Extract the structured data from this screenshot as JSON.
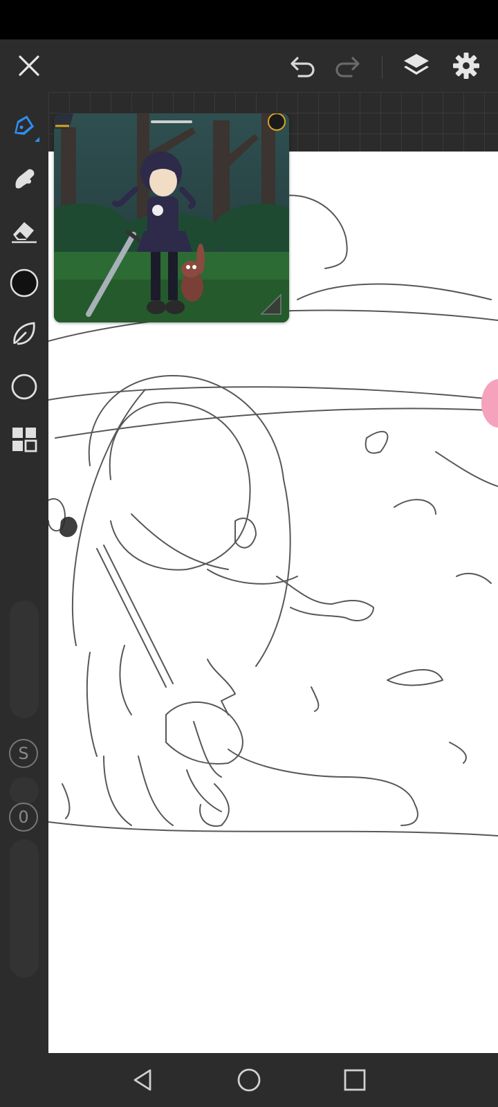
{
  "app": {
    "accent_color": "#2e8ef0",
    "toolbar_bg": "#2c2c2c",
    "canvas_bg": "#ffffff"
  },
  "topbar": {
    "icons": [
      "close-icon",
      "undo-icon",
      "redo-icon",
      "layers-icon",
      "gear-icon"
    ]
  },
  "sidebar": {
    "tools": [
      "pen-icon",
      "smudge-icon",
      "eraser-icon",
      "color-swatch",
      "lasso-icon",
      "shape-circle-icon",
      "grid-menu-icon"
    ],
    "selected_tool": "pen",
    "size_badge": "S",
    "opacity_badge": "0"
  },
  "reference_window": {
    "content": "reference-image"
  },
  "navbar": {
    "icons": [
      "back-icon",
      "home-icon",
      "recents-icon"
    ]
  }
}
